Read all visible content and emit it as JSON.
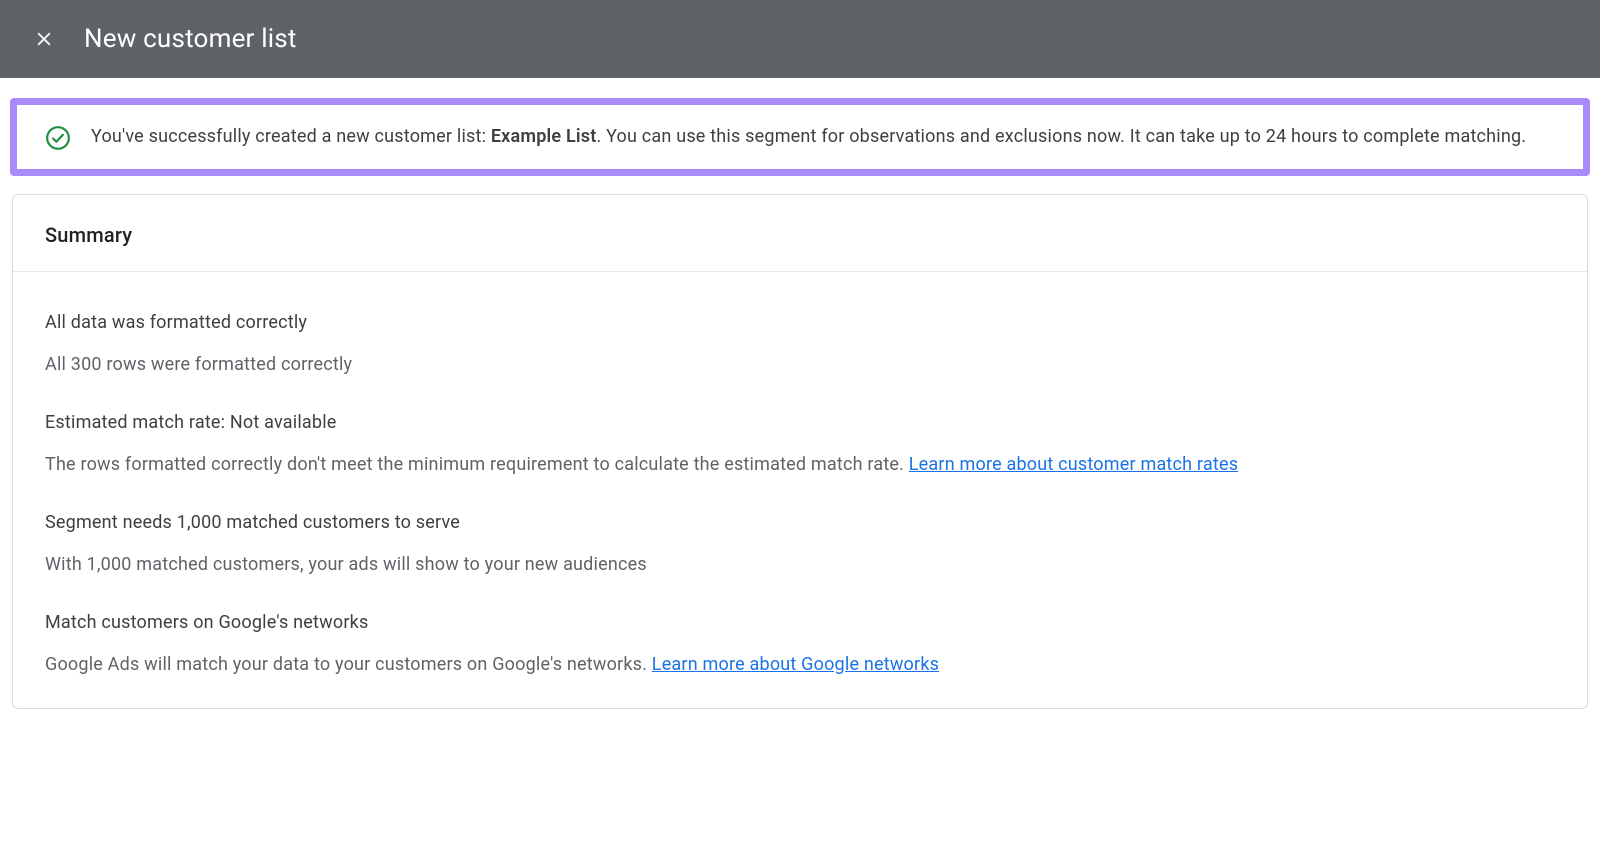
{
  "header": {
    "title": "New customer list"
  },
  "alert": {
    "prefix": "You've successfully created a new customer list: ",
    "list_name": "Example List",
    "suffix": ". You can use this segment for observations and exclusions now. It can take up to 24 hours to complete matching."
  },
  "summary": {
    "title": "Summary",
    "sections": [
      {
        "heading": "All data was formatted correctly",
        "body": "All 300 rows were formatted correctly",
        "link": null
      },
      {
        "heading": "Estimated match rate: Not available",
        "body": "The rows formatted correctly don't meet the minimum requirement to calculate the estimated match rate. ",
        "link": "Learn more about customer match rates"
      },
      {
        "heading": "Segment needs 1,000 matched customers to serve",
        "body": "With 1,000 matched customers, your ads will show to your new audiences",
        "link": null
      },
      {
        "heading": "Match customers on Google's networks",
        "body": "Google Ads will match your data to your customers on Google's networks. ",
        "link": "Learn more about Google networks"
      }
    ]
  }
}
